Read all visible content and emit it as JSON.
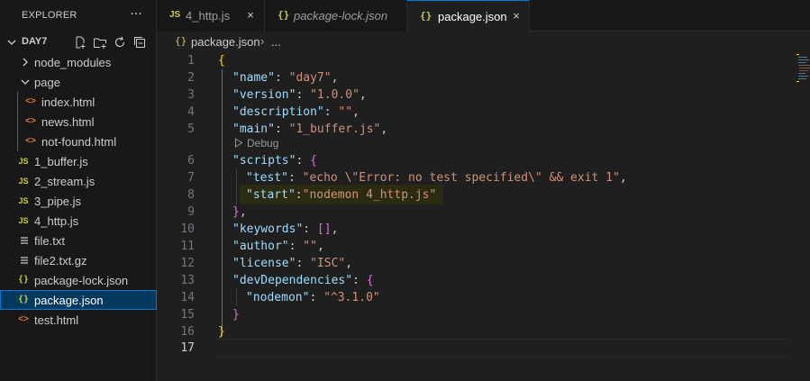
{
  "explorer": {
    "title": "EXPLORER",
    "more_icon": "ellipsis-icon",
    "folder": {
      "name": "DAY7",
      "actions": [
        "new-file-icon",
        "new-folder-icon",
        "refresh-icon",
        "collapse-all-icon"
      ]
    },
    "items": [
      {
        "label": "node_modules",
        "icon": "chevron-right-icon"
      },
      {
        "label": "page",
        "icon": "chevron-down-icon"
      },
      {
        "label": "index.html",
        "icon": "html-file-icon"
      },
      {
        "label": "news.html",
        "icon": "html-file-icon"
      },
      {
        "label": "not-found.html",
        "icon": "html-file-icon"
      },
      {
        "label": "1_buffer.js",
        "icon": "js-file-icon"
      },
      {
        "label": "2_stream.js",
        "icon": "js-file-icon"
      },
      {
        "label": "3_pipe.js",
        "icon": "js-file-icon"
      },
      {
        "label": "4_http.js",
        "icon": "js-file-icon"
      },
      {
        "label": "file.txt",
        "icon": "text-file-icon"
      },
      {
        "label": "file2.txt.gz",
        "icon": "text-file-icon"
      },
      {
        "label": "package-lock.json",
        "icon": "json-file-icon"
      },
      {
        "label": "package.json",
        "icon": "json-file-icon",
        "selected": true
      },
      {
        "label": "test.html",
        "icon": "html-file-icon"
      }
    ],
    "js_badge": "JS",
    "json_badge": "{}",
    "html_badge": "<>"
  },
  "tabs": [
    {
      "label": "4_http.js",
      "icon": "js-file-icon",
      "badge": "JS",
      "close": "×"
    },
    {
      "label": "package-lock.json",
      "icon": "json-file-icon",
      "badge": "{}",
      "italic": true
    },
    {
      "label": "package.json",
      "icon": "json-file-icon",
      "badge": "{}",
      "active": true,
      "close": "×"
    }
  ],
  "breadcrumb": {
    "icon_badge": "{}",
    "file": "package.json",
    "separator": "›",
    "more": "..."
  },
  "editor": {
    "line_numbers": [
      "1",
      "2",
      "3",
      "4",
      "5",
      "6",
      "7",
      "8",
      "9",
      "10",
      "11",
      "12",
      "13",
      "14",
      "15",
      "16",
      "17"
    ],
    "current_line": "17",
    "codelens": "Debug",
    "lines": {
      "l1_open": "{",
      "name_key": "\"name\"",
      "name_val": "\"day7\"",
      "version_key": "\"version\"",
      "version_val": "\"1.0.0\"",
      "description_key": "\"description\"",
      "description_val": "\"\"",
      "main_key": "\"main\"",
      "main_val": "\"1_buffer.js\"",
      "scripts_key": "\"scripts\"",
      "test_key": "\"test\"",
      "test_val": "\"echo \\\"Error: no test specified\\\" && exit 1\"",
      "start_key": "\"start\"",
      "start_val": "\"nodemon 4_http.js\"",
      "keywords_key": "\"keywords\"",
      "keywords_val": "[]",
      "author_key": "\"author\"",
      "author_val": "\"\"",
      "license_key": "\"license\"",
      "license_val": "\"ISC\"",
      "devdeps_key": "\"devDependencies\"",
      "nodemon_key": "\"nodemon\"",
      "nodemon_val": "\"^3.1.0\"",
      "close_brace": "}",
      "open_brace": "{",
      "colon": ": ",
      "colon_tight": ":",
      "comma": ",",
      "close_brace_comma": "},"
    }
  },
  "colors": {
    "background": "#1f1f1f",
    "sidebar": "#181818",
    "accent": "#0078d4",
    "json_key": "#9cdcfe",
    "json_string": "#ce9178",
    "bracket_gold": "#ffd700",
    "bracket_purple": "#da70d6",
    "bracket_blue": "#179fff"
  }
}
